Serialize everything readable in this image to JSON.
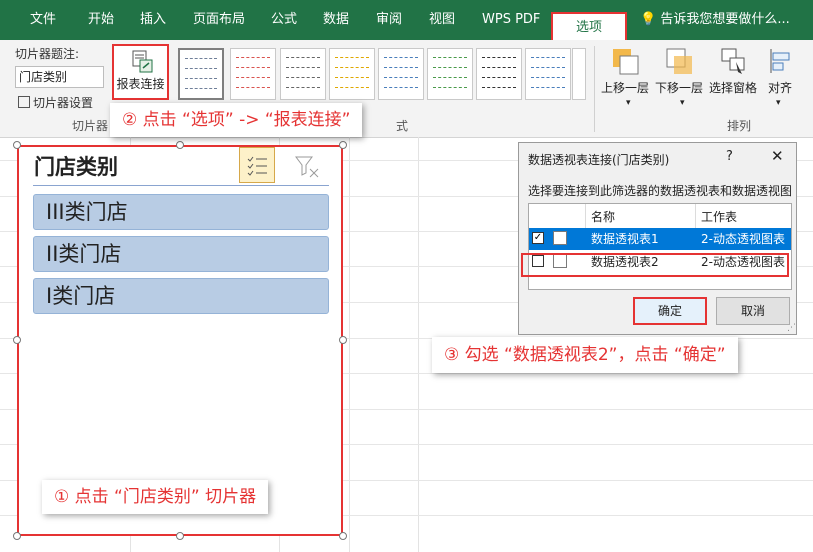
{
  "ribbon": {
    "tabs": [
      {
        "label": "文件"
      },
      {
        "label": "开始"
      },
      {
        "label": "插入"
      },
      {
        "label": "页面布局"
      },
      {
        "label": "公式"
      },
      {
        "label": "数据"
      },
      {
        "label": "审阅"
      },
      {
        "label": "视图"
      },
      {
        "label": "WPS PDF"
      },
      {
        "label": "选项"
      }
    ],
    "active_tab": "选项",
    "tell_me": "告诉我您想要做什么...",
    "slicer_caption_label": "切片器题注:",
    "slicer_caption_value": "门店类别",
    "slicer_settings": "切片器设置",
    "group_slicer": "切片器",
    "report_connections": "报表连接",
    "group_styles_partial": "式",
    "bring_forward": "上移一层",
    "send_backward": "下移一层",
    "selection_pane": "选择窗格",
    "align": "对齐",
    "group_arrange": "排列"
  },
  "slicer": {
    "title": "门店类别",
    "items": [
      "III类门店",
      "II类门店",
      "I类门店"
    ]
  },
  "callouts": {
    "step1": "①  点击 “门店类别” 切片器",
    "step2": "②  点击 “选项” -> “报表连接”",
    "step3": "③  勾选 “数据透视表2”，点击 “确定”"
  },
  "dialog": {
    "title": "数据透视表连接(门店类别)",
    "help": "?",
    "close": "✕",
    "description": "选择要连接到此筛选器的数据透视表和数据透视图",
    "col_name": "名称",
    "col_sheet": "工作表",
    "rows": [
      {
        "name": "数据透视表1",
        "sheet": "2-动态透视图表",
        "checked": true
      },
      {
        "name": "数据透视表2",
        "sheet": "2-动态透视图表",
        "checked": false
      }
    ],
    "ok": "确定",
    "cancel": "取消"
  },
  "colors": {
    "ribbon_green": "#217346",
    "highlight_red": "#e53333",
    "slicer_item": "#b8cce4",
    "selected_row": "#0078d7"
  }
}
